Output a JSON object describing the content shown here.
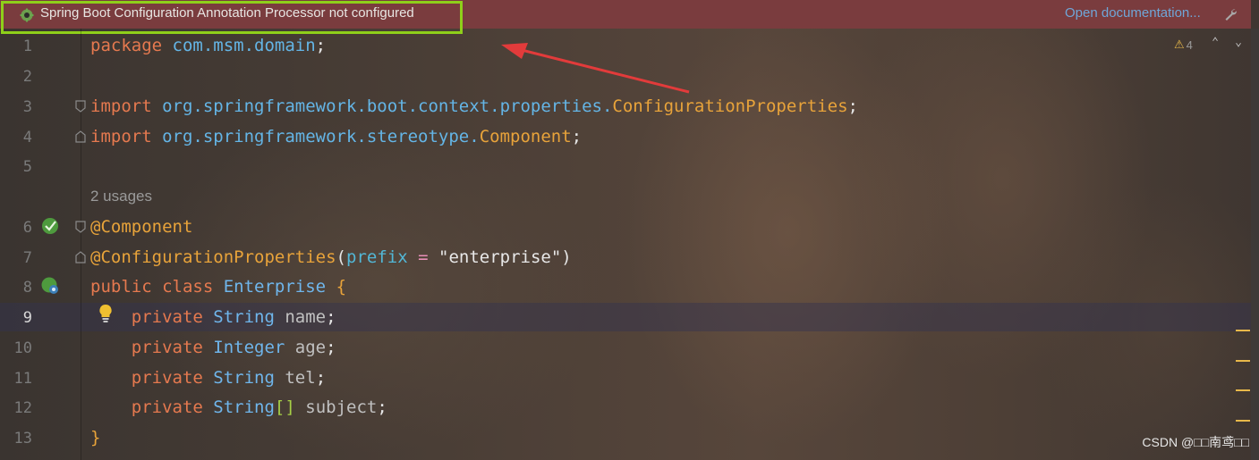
{
  "banner": {
    "message": "Spring Boot Configuration Annotation Processor not configured",
    "link_label": "Open documentation..."
  },
  "inspections": {
    "warning_count": "4"
  },
  "editor": {
    "line_numbers": [
      "1",
      "2",
      "3",
      "4",
      "5",
      "6",
      "7",
      "8",
      "9",
      "10",
      "11",
      "12",
      "13"
    ],
    "current_line": "9",
    "usages_hint": "2 usages",
    "lines": {
      "l1": [
        [
          "kw",
          "package "
        ],
        [
          "pk",
          "com.msm.domain"
        ],
        [
          "pl",
          ";"
        ]
      ],
      "l3": [
        [
          "kw",
          "import "
        ],
        [
          "pk",
          "org.springframework.boot.context.properties."
        ],
        [
          "cl",
          "ConfigurationProperties"
        ],
        [
          "pl",
          ";"
        ]
      ],
      "l4": [
        [
          "kw",
          "import "
        ],
        [
          "pk",
          "org.springframework.stereotype."
        ],
        [
          "cl",
          "Component"
        ],
        [
          "pl",
          ";"
        ]
      ],
      "l6": [
        [
          "an",
          "@Component"
        ]
      ],
      "l7": [
        [
          "an",
          "@ConfigurationProperties"
        ],
        [
          "pl",
          "("
        ],
        [
          "pr",
          "prefix"
        ],
        [
          "pl",
          " "
        ],
        [
          "op",
          "="
        ],
        [
          "pl",
          " "
        ],
        [
          "st",
          "\"enterprise\""
        ],
        [
          "pl",
          ")"
        ]
      ],
      "l8": [
        [
          "kw",
          "public class "
        ],
        [
          "ty",
          "Enterprise "
        ],
        [
          "cl",
          "{"
        ]
      ],
      "l9": [
        [
          "pl",
          "    "
        ],
        [
          "kw",
          "private "
        ],
        [
          "ty",
          "String "
        ],
        [
          "fd",
          "name"
        ],
        [
          "pl",
          ";"
        ]
      ],
      "l10": [
        [
          "pl",
          "    "
        ],
        [
          "kw",
          "private "
        ],
        [
          "ty",
          "Integer "
        ],
        [
          "fd",
          "age"
        ],
        [
          "pl",
          ";"
        ]
      ],
      "l11": [
        [
          "pl",
          "    "
        ],
        [
          "kw",
          "private "
        ],
        [
          "ty",
          "String "
        ],
        [
          "fd",
          "tel"
        ],
        [
          "pl",
          ";"
        ]
      ],
      "l12": [
        [
          "pl",
          "    "
        ],
        [
          "kw",
          "private "
        ],
        [
          "ty",
          "String"
        ],
        [
          "br",
          "[] "
        ],
        [
          "fd",
          "subject"
        ],
        [
          "pl",
          ";"
        ]
      ],
      "l13": [
        [
          "cl",
          "}"
        ]
      ]
    }
  },
  "watermark": "CSDN @□□南鸢□□",
  "colors": {
    "banner_bg": "#7a3c3e",
    "highlight_border": "#8fcf1a",
    "keyword": "#e5794f",
    "annotation": "#e8a33a",
    "link": "#6fa6d8"
  }
}
